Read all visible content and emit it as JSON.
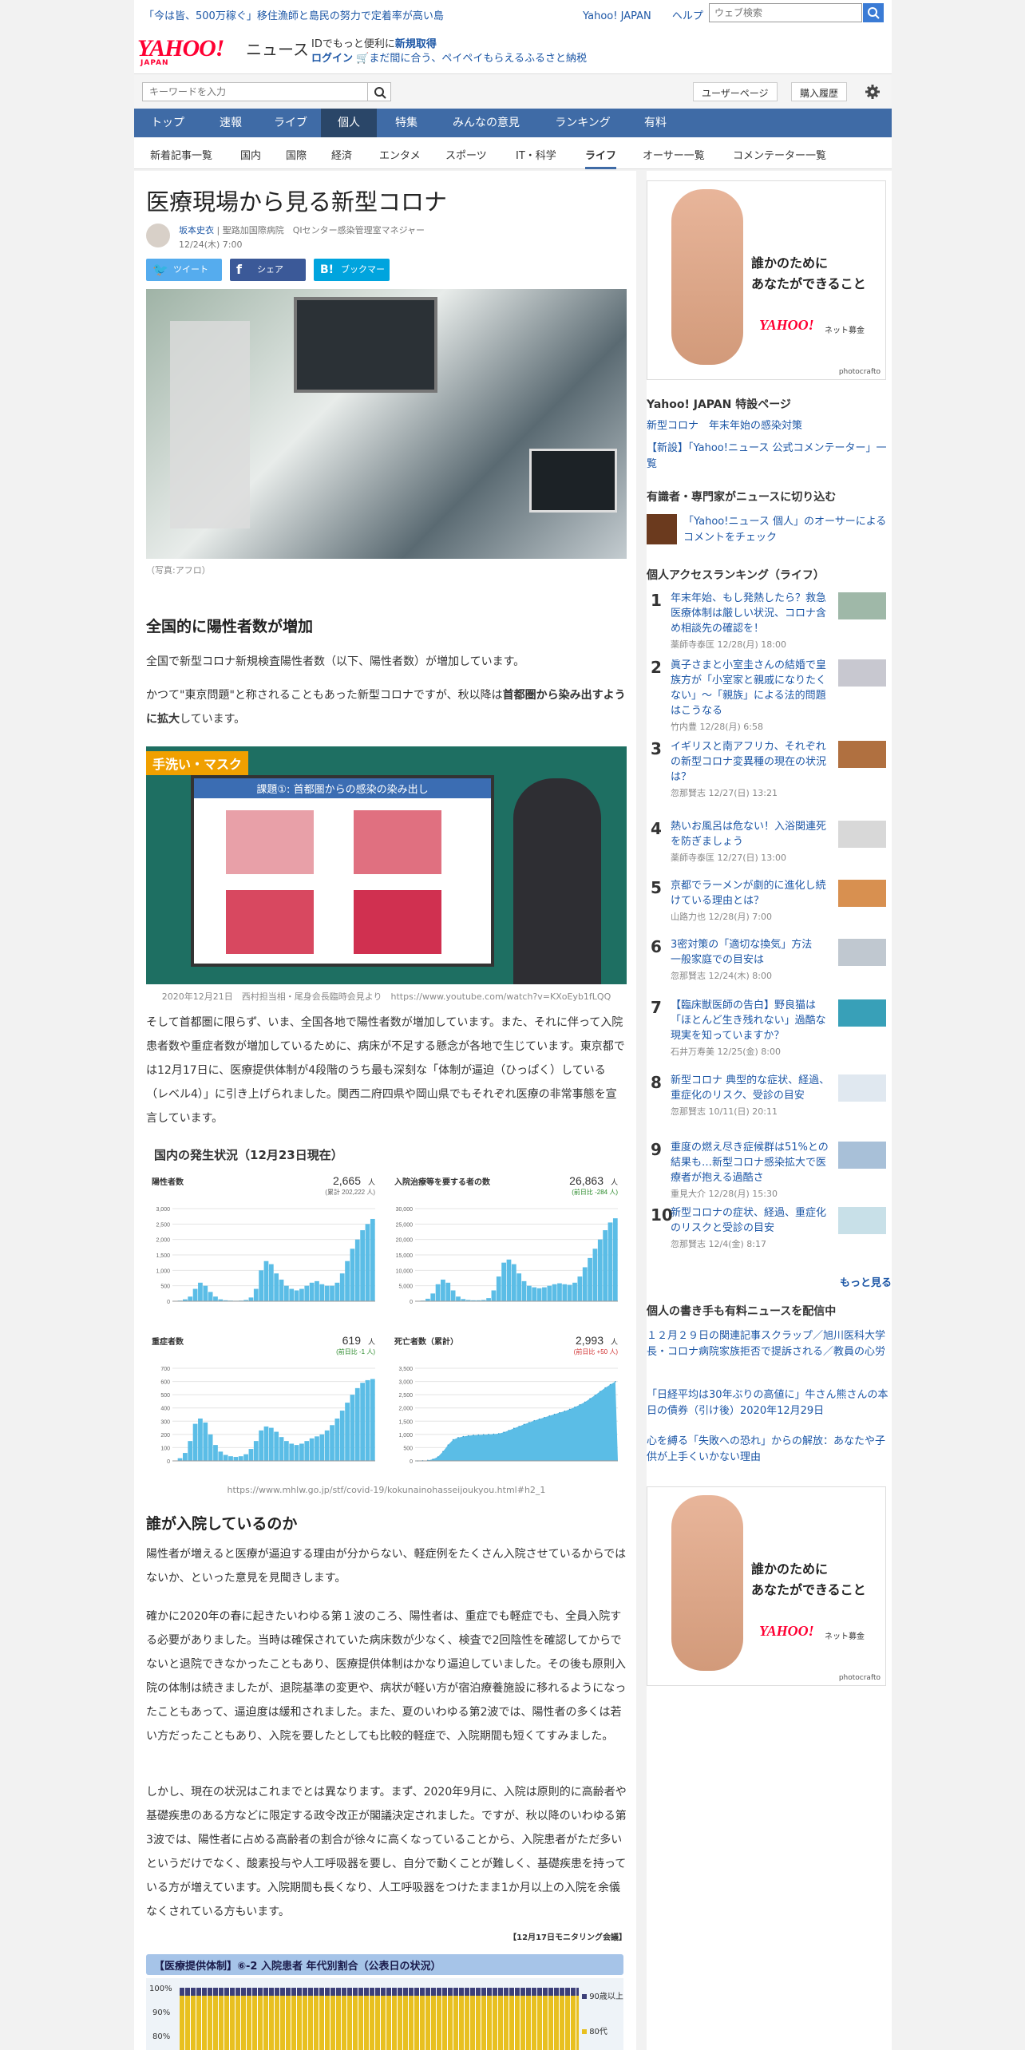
{
  "topbar": {
    "promo": "「今は皆、500万稼ぐ」移住漁師と島民の努力で定着率が高い島",
    "link1": "Yahoo! JAPAN",
    "link2": "ヘルプ",
    "search_placeholder": "ウェブ検索"
  },
  "header": {
    "logo": "YAHOO!",
    "logo_sub": "JAPAN",
    "news": "ニュース",
    "login_text": "IDでもっと便利に",
    "login_new": "新規取得",
    "login": "ログイン",
    "promo": "まだ間に合う、ペイペイもらえるふるさと納税"
  },
  "searchrow": {
    "placeholder": "キーワードを入力",
    "userpage": "ユーザーページ",
    "history": "購入履歴"
  },
  "nav": [
    "トップ",
    "速報",
    "ライブ",
    "個人",
    "特集",
    "みんなの意見",
    "ランキング",
    "有料"
  ],
  "subnav": [
    "新着記事一覧",
    "国内",
    "国際",
    "経済",
    "エンタメ",
    "スポーツ",
    "IT・科学",
    "ライフ",
    "オーサー一覧",
    "コメンテーター一覧"
  ],
  "article": {
    "title": "医療現場から見る新型コロナ",
    "author": "坂本史衣",
    "affil": "| 聖路加国際病院　QIセンター感染管理室マネジャー",
    "date": "12/24(木) 7:00",
    "tweet": "ツイート",
    "share": "シェア",
    "bookmark": "ブックマーク",
    "photo_credit": "（写真:アフロ）",
    "h1": "全国的に陽性者数が増加",
    "p1": "全国で新型コロナ新規検査陽性者数（以下、陽性者数）が増加しています。",
    "p2a": "かつて\"東京問題\"と称されることもあった新型コロナですが、秋以降は",
    "p2b": "首都圏から染み出すように拡大",
    "p2c": "しています。",
    "img2_label": "手洗い・マスク",
    "img2_screen": "課題①: 首都圏からの感染の染み出し",
    "img2_caption": "2020年12月21日　西村担当相・尾身会長臨時会見より　https://www.youtube.com/watch?v=KXoEyb1fLQQ",
    "p3": "そして首都圏に限らず、いま、全国各地で陽性者数が増加しています。また、それに伴って入院患者数や重症者数が増加しているために、病床が不足する懸念が各地で生じています。東京都では12月17日に、医療提供体制が4段階のうち最も深刻な「体制が逼迫（ひっぱく）している（レベル4）」に引き上げられました。関西二府四県や岡山県でもそれぞれ医療の非常事態を宣言しています。",
    "charts_title": "国内の発生状況（12月23日現在）",
    "chart_src": "https://www.mhlw.go.jp/stf/covid-19/kokunainohasseijoukyou.html#h2_1",
    "h2": "誰が入院しているのか",
    "p4": "陽性者が増えると医療が逼迫する理由が分からない、軽症例をたくさん入院させているからではないか、といった意見を見聞きします。",
    "p5": "確かに2020年の春に起きたいわゆる第１波のころ、陽性者は、重症でも軽症でも、全員入院する必要がありました。当時は確保されていた病床数が少なく、検査で2回陰性を確認してからでないと退院できなかったこともあり、医療提供体制はかなり逼迫していました。その後も原則入院の体制は続きましたが、退院基準の変更や、病状が軽い方が宿泊療養施設に移れるようになったこともあって、逼迫度は緩和されました。また、夏のいわゆる第2波では、陽性者の多くは若い方だったこともあり、入院を要したとしても比較的軽症で、入院期間も短くてすみました。",
    "p6": "しかし、現在の状況はこれまでとは異なります。まず、2020年9月に、入院は原則的に高齢者や基礎疾患のある方などに限定する政令改正が閣議決定されました。ですが、秋以降のいわゆる第3波では、陽性者に占める高齢者の割合が徐々に高くなっていることから、入院患者がただ多いというだけでなく、酸素投与や人工呼吸器を要し、自分で動くことが難しく、基礎疾患を持っている方が増えています。入院期間も長くなり、人工呼吸器をつけたまま1か月以上の入院を余儀なくされている方もいます。",
    "source_note": "【12月17日モニタリング会議】",
    "fig_title": "【医療提供体制】⑥-2 入院患者 年代別割合（公表日の状況）",
    "fig_y": [
      "100%",
      "90%",
      "80%"
    ],
    "fig_legend": [
      "90歳以上",
      "80代"
    ]
  },
  "chart_data": [
    {
      "type": "bar",
      "title": "陽性者数",
      "value": "2,665",
      "unit": "人",
      "sub": "(累計 202,222 人)",
      "yticks": [
        "3,000",
        "2,500",
        "2,000",
        "1,500",
        "1,000",
        "500",
        "0"
      ],
      "ylim": [
        0,
        3000
      ],
      "values": [
        0,
        20,
        60,
        150,
        400,
        600,
        500,
        300,
        150,
        60,
        30,
        20,
        15,
        20,
        40,
        120,
        400,
        1000,
        1300,
        1200,
        900,
        700,
        500,
        400,
        350,
        400,
        500,
        600,
        650,
        550,
        500,
        500,
        600,
        900,
        1300,
        1700,
        2000,
        2300,
        2500,
        2665
      ]
    },
    {
      "type": "bar",
      "title": "入院治療等を要する者の数",
      "value": "26,863",
      "unit": "人",
      "sub": "(前日比 -284 人)",
      "yticks": [
        "30,000",
        "25,000",
        "20,000",
        "15,000",
        "10,000",
        "5,000",
        "0"
      ],
      "ylim": [
        0,
        30000
      ],
      "values": [
        0,
        200,
        800,
        2500,
        5500,
        7000,
        6000,
        3500,
        1500,
        700,
        400,
        300,
        300,
        400,
        1000,
        3500,
        8000,
        12500,
        13500,
        12000,
        9000,
        6500,
        5000,
        4500,
        4200,
        4500,
        5000,
        5500,
        5800,
        5500,
        5300,
        6000,
        8000,
        11000,
        14000,
        17000,
        20000,
        23000,
        25500,
        26863
      ]
    },
    {
      "type": "bar",
      "title": "重症者数",
      "value": "619",
      "unit": "人",
      "sub": "(前日比 -1 人)",
      "yticks": [
        "700",
        "600",
        "500",
        "400",
        "300",
        "200",
        "100",
        "0"
      ],
      "ylim": [
        0,
        700
      ],
      "values": [
        0,
        20,
        60,
        150,
        280,
        320,
        290,
        200,
        120,
        70,
        45,
        35,
        30,
        35,
        50,
        90,
        150,
        230,
        260,
        250,
        220,
        180,
        150,
        130,
        120,
        130,
        150,
        170,
        185,
        200,
        230,
        270,
        320,
        380,
        440,
        500,
        550,
        590,
        610,
        619
      ]
    },
    {
      "type": "area",
      "title": "死亡者数（累計）",
      "value": "2,993",
      "unit": "人",
      "sub": "(前日比 +50 人)",
      "yticks": [
        "3,500",
        "3,000",
        "2,500",
        "2,000",
        "1,500",
        "1,000",
        "500",
        "0"
      ],
      "ylim": [
        0,
        3500
      ],
      "values": [
        0,
        5,
        20,
        60,
        150,
        350,
        600,
        800,
        880,
        920,
        950,
        970,
        980,
        990,
        1000,
        1010,
        1030,
        1080,
        1150,
        1230,
        1300,
        1380,
        1450,
        1520,
        1580,
        1640,
        1700,
        1760,
        1820,
        1880,
        1950,
        2030,
        2120,
        2220,
        2350,
        2480,
        2620,
        2760,
        2880,
        2993
      ]
    }
  ],
  "side": {
    "ad_text1": "誰かのために",
    "ad_text2": "あなたができること",
    "ad_yahoo": "YAHOO!",
    "ad_net": "ネット募金",
    "ad_photo": "photocrafto",
    "special_title": "Yahoo! JAPAN 特設ページ",
    "special1": "新型コロナ　年末年始の感染対策",
    "special2": "【新設】「Yahoo!ニュース 公式コメンテーター」一覧",
    "experts_title": "有識者・専門家がニュースに切り込む",
    "experts_link": "「Yahoo!ニュース 個人」のオーサーによるコメントをチェック",
    "ranking_title": "個人アクセスランキング（ライフ）",
    "ranking": [
      {
        "n": "1",
        "t": "年末年始、もし発熱したら？救急医療体制は厳しい状況、コロナ含め相談先の確認を！",
        "m": "薬師寺泰匡 12/28(月) 18:00"
      },
      {
        "n": "2",
        "t": "眞子さまと小室圭さんの結婚で皇族方が「小室家と親戚になりたくない」～「親族」による法的問題はこうなる",
        "m": "竹内豊 12/28(月) 6:58"
      },
      {
        "n": "3",
        "t": "イギリスと南アフリカ、それぞれの新型コロナ変異種の現在の状況は？",
        "m": "忽那賢志 12/27(日) 13:21"
      },
      {
        "n": "4",
        "t": "熱いお風呂は危ない！入浴関連死を防ぎましょう",
        "m": "薬師寺泰匡 12/27(日) 13:00"
      },
      {
        "n": "5",
        "t": "京都でラーメンが劇的に進化し続けている理由とは？",
        "m": "山路力也 12/28(月) 7:00"
      },
      {
        "n": "6",
        "t": "3密対策の「適切な換気」方法　一般家庭での目安は",
        "m": "忽那賢志 12/24(木) 8:00"
      },
      {
        "n": "7",
        "t": "【臨床獣医師の告白】野良猫は「ほとんど生き残れない」過酷な現実を知っていますか？",
        "m": "石井万寿美 12/25(金) 8:00"
      },
      {
        "n": "8",
        "t": "新型コロナ 典型的な症状、経過、重症化のリスク、受診の目安",
        "m": "忽那賢志 10/11(日) 20:11"
      },
      {
        "n": "9",
        "t": "重度の燃え尽き症候群は51%との結果も…新型コロナ感染拡大で医療者が抱える過酷さ",
        "m": "重見大介 12/28(月) 15:30"
      },
      {
        "n": "10",
        "t": "新型コロナの症状、経過、重症化のリスクと受診の目安",
        "m": "忽那賢志 12/4(金) 8:17"
      }
    ],
    "more": "もっと見る",
    "paid_title": "個人の書き手も有料ニュースを配信中",
    "paid": [
      "１２月２９日の関連記事スクラップ／旭川医科大学長・コロナ病院家族拒否で提訴される／教員の心労",
      "「日経平均は30年ぶりの高値に」牛さん熊さんの本日の債券（引け後）2020年12月29日",
      "心を縛る「失敗への恐れ」からの解放：あなたや子供が上手くいかない理由"
    ]
  }
}
